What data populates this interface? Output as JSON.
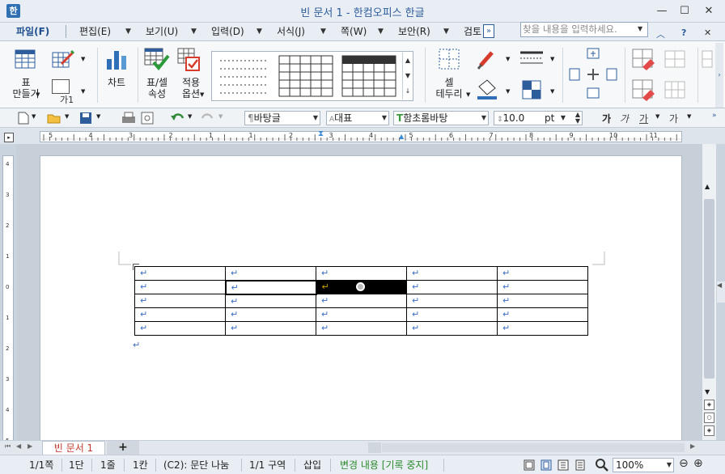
{
  "window": {
    "title": "빈 문서 1 - 한컴오피스 한글",
    "icon_glyph": "한",
    "min": "—",
    "max": "☐",
    "close": "✕"
  },
  "menu": {
    "items": [
      "파일(F)",
      "편집(E)",
      "보기(U)",
      "입력(D)",
      "서식(J)",
      "쪽(W)",
      "보안(R)",
      "검토"
    ],
    "more": "»",
    "search_placeholder": "찾을 내용을 입력하세요.",
    "ribbon_collapse": "︿",
    "help": "?",
    "close": "✕"
  },
  "ribbon": {
    "table_make": [
      "표",
      "만들기"
    ],
    "table_make_sub": "가1",
    "chart": "차트",
    "cell_props": [
      "표/셀",
      "속성"
    ],
    "apply_opts": [
      "적용",
      "옵션"
    ],
    "cell_border": [
      "셀",
      "테두리"
    ]
  },
  "toolbar2": {
    "style": "바탕글",
    "lang": "대표",
    "font": "함초롬바탕",
    "size": "10.0",
    "unit": "pt",
    "bold": "가",
    "italic": "가",
    "underline": "가",
    "strike": "가"
  },
  "hruler": {
    "ticks": [
      "5",
      "4",
      "3",
      "2",
      "1",
      "1",
      "2",
      "3",
      "4",
      "5",
      "6",
      "7",
      "8",
      "9",
      "10",
      "11"
    ]
  },
  "vruler": {
    "ticks": [
      "4",
      "3",
      "2",
      "1",
      "0",
      "1",
      "2",
      "3",
      "4",
      "5"
    ]
  },
  "document": {
    "para_mark": "↵",
    "rows": 5,
    "cols": 5
  },
  "tabs": {
    "doc_tab": "빈 문서 1",
    "add": "+"
  },
  "status": {
    "page": "1/1쪽",
    "column": "1단",
    "line": "1줄",
    "char": "1칸",
    "cell": "(C2): 문단 나눔",
    "section": "1/1 구역",
    "insert": "삽입",
    "track": "변경 내용 [기록 중지]",
    "zoom": "100%"
  },
  "colors": {
    "accent": "#2e5d9c",
    "status_green": "#2c8a2c",
    "selection": "#000000"
  }
}
